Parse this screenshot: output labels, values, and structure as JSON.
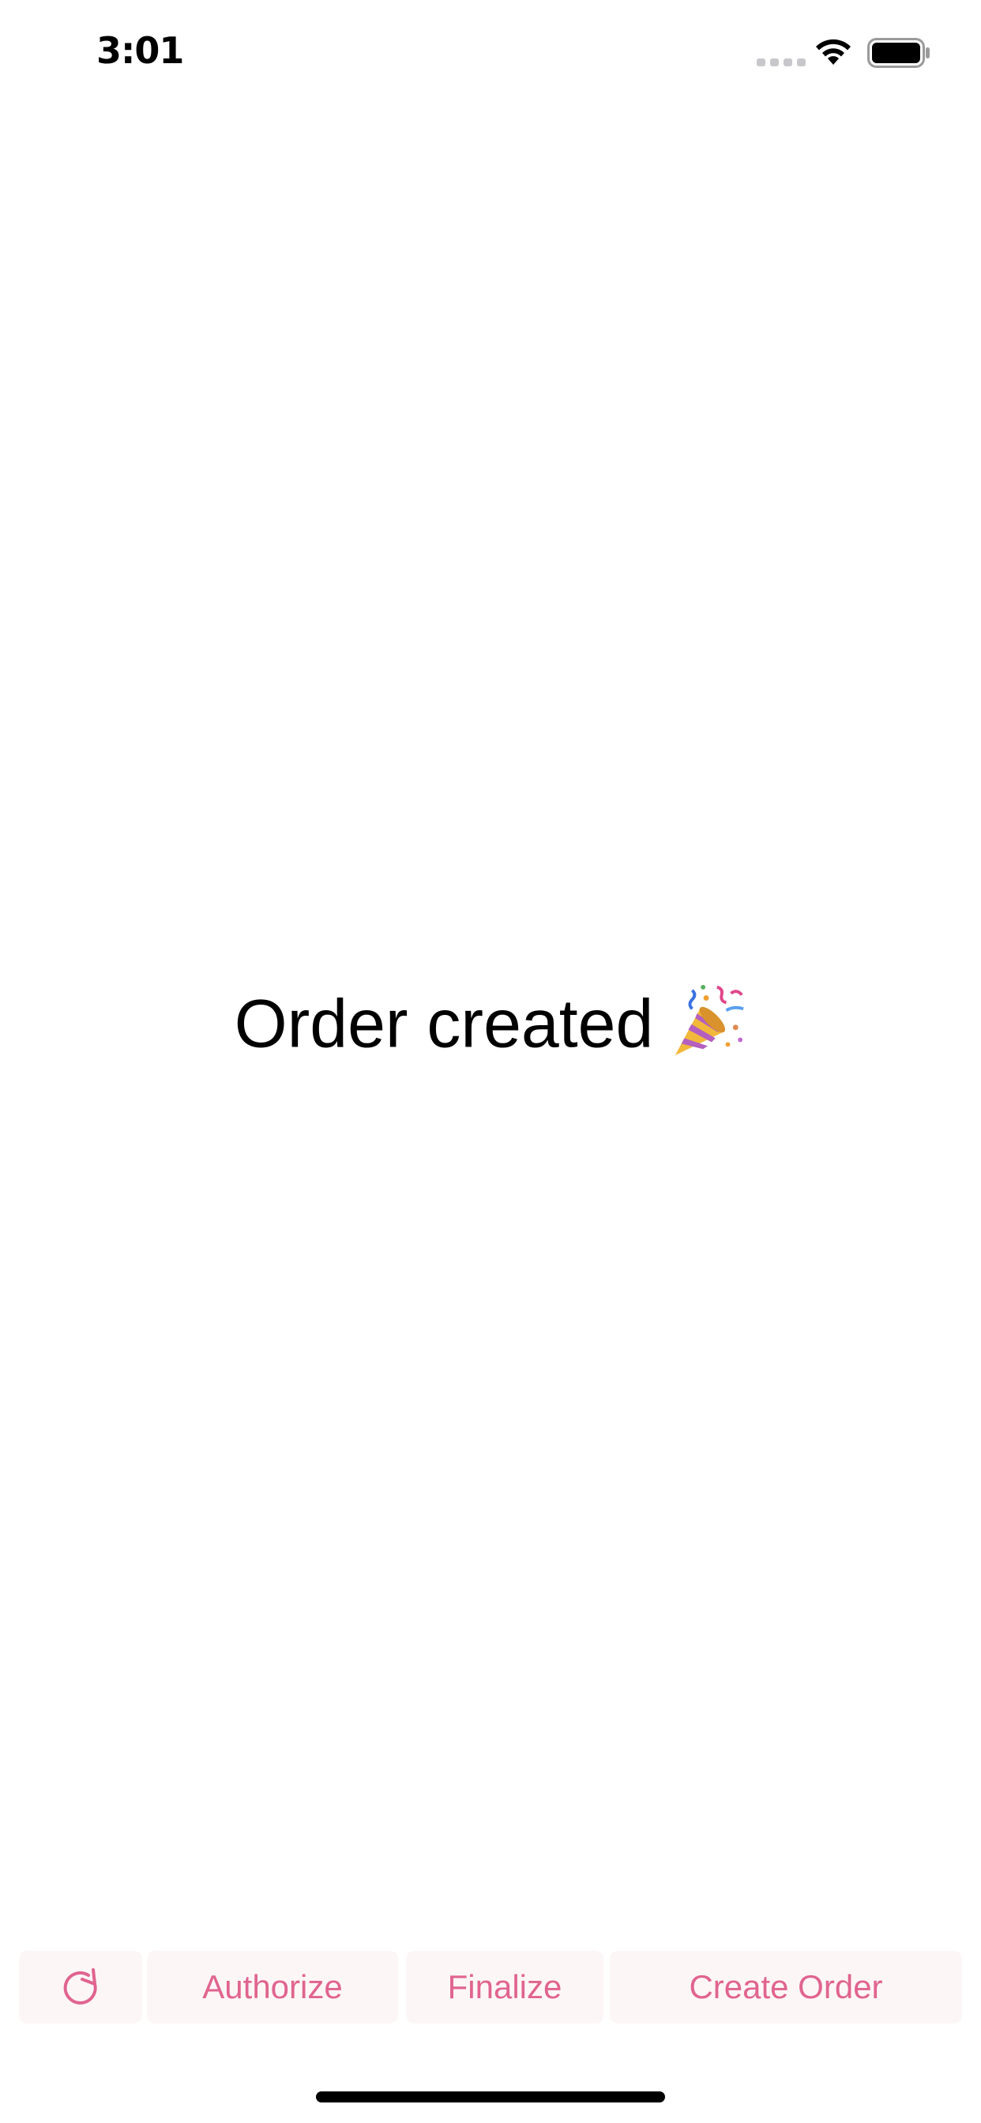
{
  "status_bar": {
    "time": "3:01",
    "icons": [
      "signal-icon",
      "wifi-icon",
      "battery-icon"
    ]
  },
  "main": {
    "message": "Order created",
    "emoji_icon": "party-popper-icon"
  },
  "toolbar": {
    "refresh_icon": "refresh-icon",
    "authorize_label": "Authorize",
    "finalize_label": "Finalize",
    "create_order_label": "Create Order"
  },
  "colors": {
    "accent": "#e0648f",
    "button_bg": "#fdf6f7",
    "text": "#000000",
    "background": "#ffffff"
  }
}
